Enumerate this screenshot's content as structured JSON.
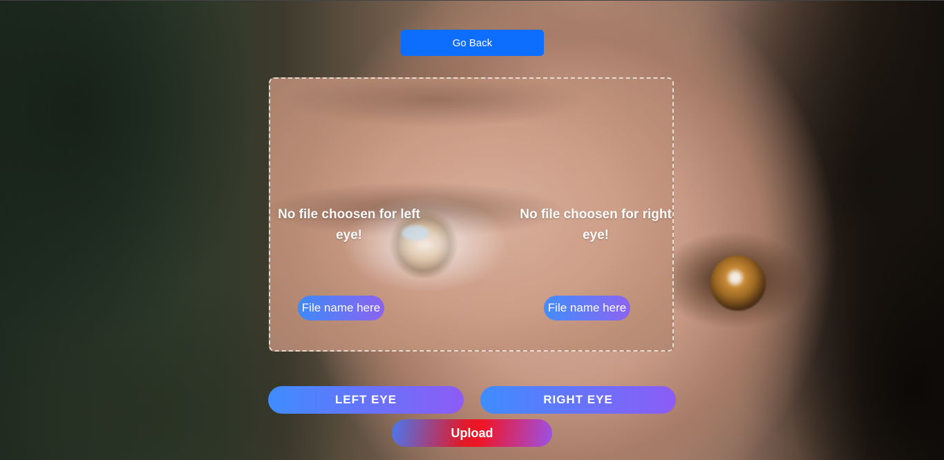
{
  "nav": {
    "go_back_label": "Go Back"
  },
  "upload_panel": {
    "left": {
      "message": "No file choosen for left eye!",
      "file_name": "File name here"
    },
    "right": {
      "message": "No file choosen for right eye!",
      "file_name": "File name here"
    }
  },
  "actions": {
    "left_eye_label": "LEFT EYE",
    "right_eye_label": "RIGHT EYE",
    "upload_label": "Upload"
  },
  "colors": {
    "go_back_bg": "#0d6efd",
    "pill_gradient_start": "#3f8cff",
    "pill_gradient_end": "#8d5cf6",
    "upload_gradient_mid": "#e01a2a"
  }
}
